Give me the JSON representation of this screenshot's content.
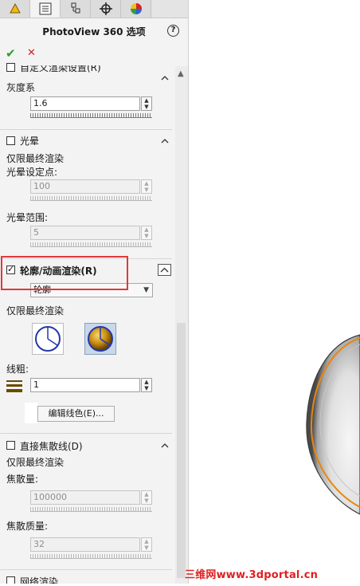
{
  "panel": {
    "title": "PhotoView 360 选项",
    "help_glyph": "?",
    "ok_glyph": "✔",
    "cancel_glyph": "✕",
    "tabs": [
      "feature-manager",
      "property-manager",
      "configuration-manager",
      "dimxpert",
      "display-manager"
    ]
  },
  "custom_render": {
    "partial_heading": "自定义渲染设置(R)",
    "gamma_label": "灰度系",
    "gamma_value": "1.6"
  },
  "bloom": {
    "heading": "光晕",
    "checked": false,
    "final_only": "仅限最终渲染",
    "setpoint_label": "光晕设定点:",
    "setpoint_value": "100",
    "range_label": "光晕范围:",
    "range_value": "5"
  },
  "contour": {
    "heading": "轮廓/动画渲染(R)",
    "checked": true,
    "mode": "轮廓",
    "final_only": "仅限最终渲染",
    "line_width_label": "线粗:",
    "line_width_value": "1",
    "edit_color_button": "编辑线色(E)..."
  },
  "caustics": {
    "heading": "直接焦散线(D)",
    "checked": false,
    "final_only": "仅限最终渲染",
    "amount_label": "焦散量:",
    "amount_value": "100000",
    "quality_label": "焦散质量:",
    "quality_value": "32"
  },
  "network": {
    "partial_heading": "网络渲染"
  },
  "watermark": "三维网www.3dportal.cn",
  "colors": {
    "highlight": "#e0393a",
    "ok_green": "#2a9d2a",
    "cancel_red": "#d42020",
    "contour_orange": "#e8860f"
  }
}
